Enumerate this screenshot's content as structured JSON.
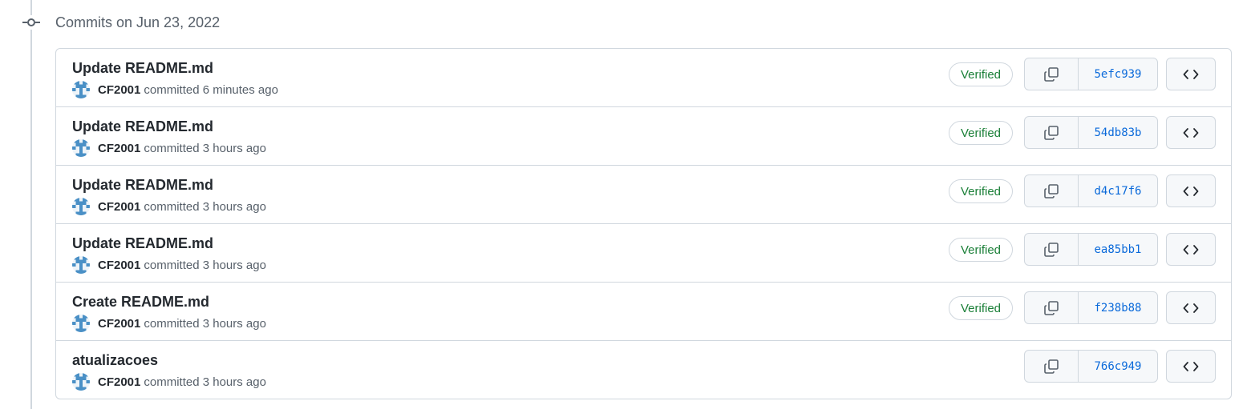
{
  "timeline": {
    "date_heading": "Commits on Jun 23, 2022",
    "icon": "git-commit-icon"
  },
  "colors": {
    "border": "#d0d7de",
    "verified_green": "#1a7f37",
    "sha_blue": "#0969da",
    "avatar_blue": "#4a90c6"
  },
  "commits": [
    {
      "title": "Update README.md",
      "author": "CF2001",
      "action": "committed",
      "time": "6 minutes ago",
      "verified": "Verified",
      "sha": "5efc939"
    },
    {
      "title": "Update README.md",
      "author": "CF2001",
      "action": "committed",
      "time": "3 hours ago",
      "verified": "Verified",
      "sha": "54db83b"
    },
    {
      "title": "Update README.md",
      "author": "CF2001",
      "action": "committed",
      "time": "3 hours ago",
      "verified": "Verified",
      "sha": "d4c17f6"
    },
    {
      "title": "Update README.md",
      "author": "CF2001",
      "action": "committed",
      "time": "3 hours ago",
      "verified": "Verified",
      "sha": "ea85bb1"
    },
    {
      "title": "Create README.md",
      "author": "CF2001",
      "action": "committed",
      "time": "3 hours ago",
      "verified": "Verified",
      "sha": "f238b88"
    },
    {
      "title": "atualizacoes",
      "author": "CF2001",
      "action": "committed",
      "time": "3 hours ago",
      "verified": "",
      "sha": "766c949"
    }
  ],
  "icons": {
    "copy": "copy-icon",
    "browse": "code-icon",
    "avatar": "identicon-avatar"
  }
}
